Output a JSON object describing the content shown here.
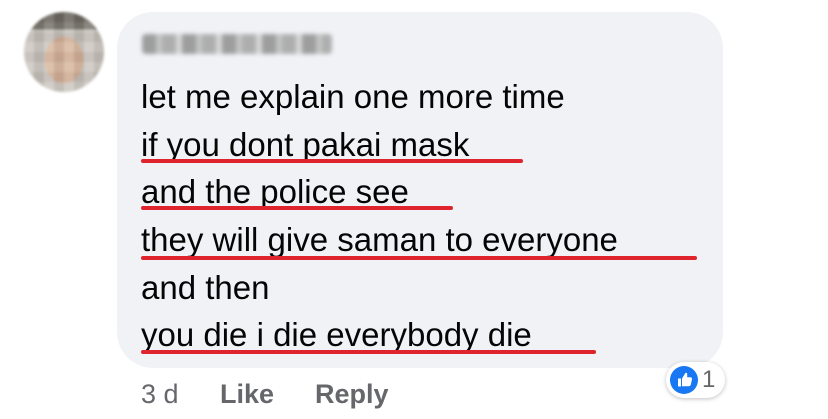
{
  "comment": {
    "author": "",
    "lines": [
      "let me explain one more time",
      "if you dont pakai mask",
      "and the police see",
      "they will give saman to everyone",
      "and then",
      "you die i die everybody die"
    ]
  },
  "footer": {
    "time": "3 d",
    "like_label": "Like",
    "reply_label": "Reply"
  },
  "reaction": {
    "icon": "thumbs-up-icon",
    "count": "1",
    "color": "#1877f2"
  },
  "annotation_color": "#e0242e"
}
